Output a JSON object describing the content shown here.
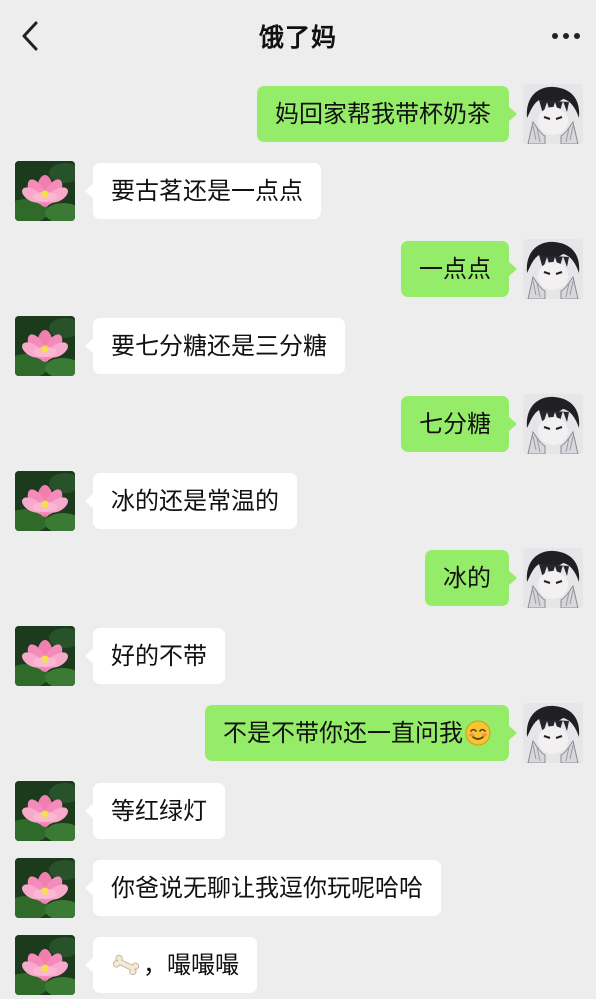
{
  "header": {
    "title": "饿了妈",
    "back_icon": "chevron-left-icon",
    "more_icon": "more-dots-icon"
  },
  "colors": {
    "background": "#ededed",
    "sent_bubble": "#95ec69",
    "received_bubble": "#ffffff"
  },
  "messages": [
    {
      "from": "me",
      "text": "妈回家帮我带杯奶茶"
    },
    {
      "from": "mom",
      "text": "要古茗还是一点点"
    },
    {
      "from": "me",
      "text": "一点点"
    },
    {
      "from": "mom",
      "text": "要七分糖还是三分糖"
    },
    {
      "from": "me",
      "text": "七分糖"
    },
    {
      "from": "mom",
      "text": "冰的还是常温的"
    },
    {
      "from": "me",
      "text": "冰的"
    },
    {
      "from": "mom",
      "text": "好的不带"
    },
    {
      "from": "me",
      "text": "不是不带你还一直问我",
      "emoji": "smiling-face-icon"
    },
    {
      "from": "mom",
      "text": "等红绿灯"
    },
    {
      "from": "mom",
      "text": "你爸说无聊让我逗你玩呢哈哈"
    },
    {
      "from": "mom",
      "text": "，嘬嘬嘬",
      "emoji_prefix": "bone-icon"
    }
  ]
}
